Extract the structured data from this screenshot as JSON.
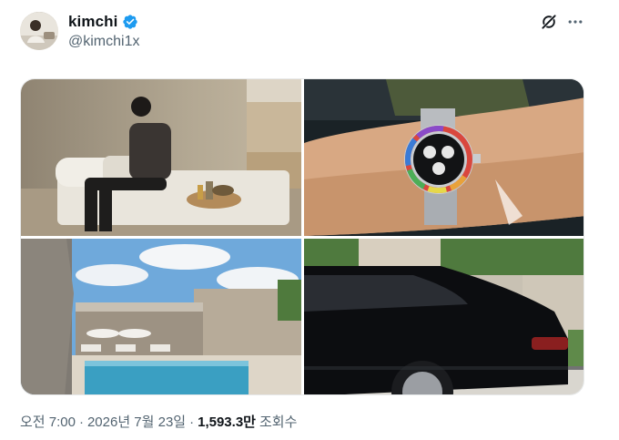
{
  "author": {
    "display_name": "kimchi",
    "handle": "@kimchi1x",
    "verified": true,
    "avatar_icon": "profile-photo"
  },
  "header_actions": {
    "grok_icon": "grok-icon",
    "more_icon": "more-dots-icon"
  },
  "media": [
    {
      "name": "photo-man-sitting-on-bench"
    },
    {
      "name": "photo-rainbow-watch-on-wrist"
    },
    {
      "name": "photo-pool-villa"
    },
    {
      "name": "photo-black-car"
    }
  ],
  "meta": {
    "time": "오전 7:00",
    "separator": "·",
    "date": "2026년 7월 23일",
    "views_count": "1,593.3만",
    "views_label": "조회수"
  },
  "colors": {
    "text_primary": "#0f1419",
    "text_secondary": "#536471",
    "verified_blue": "#1d9bf0",
    "border": "#e7e9ea"
  }
}
